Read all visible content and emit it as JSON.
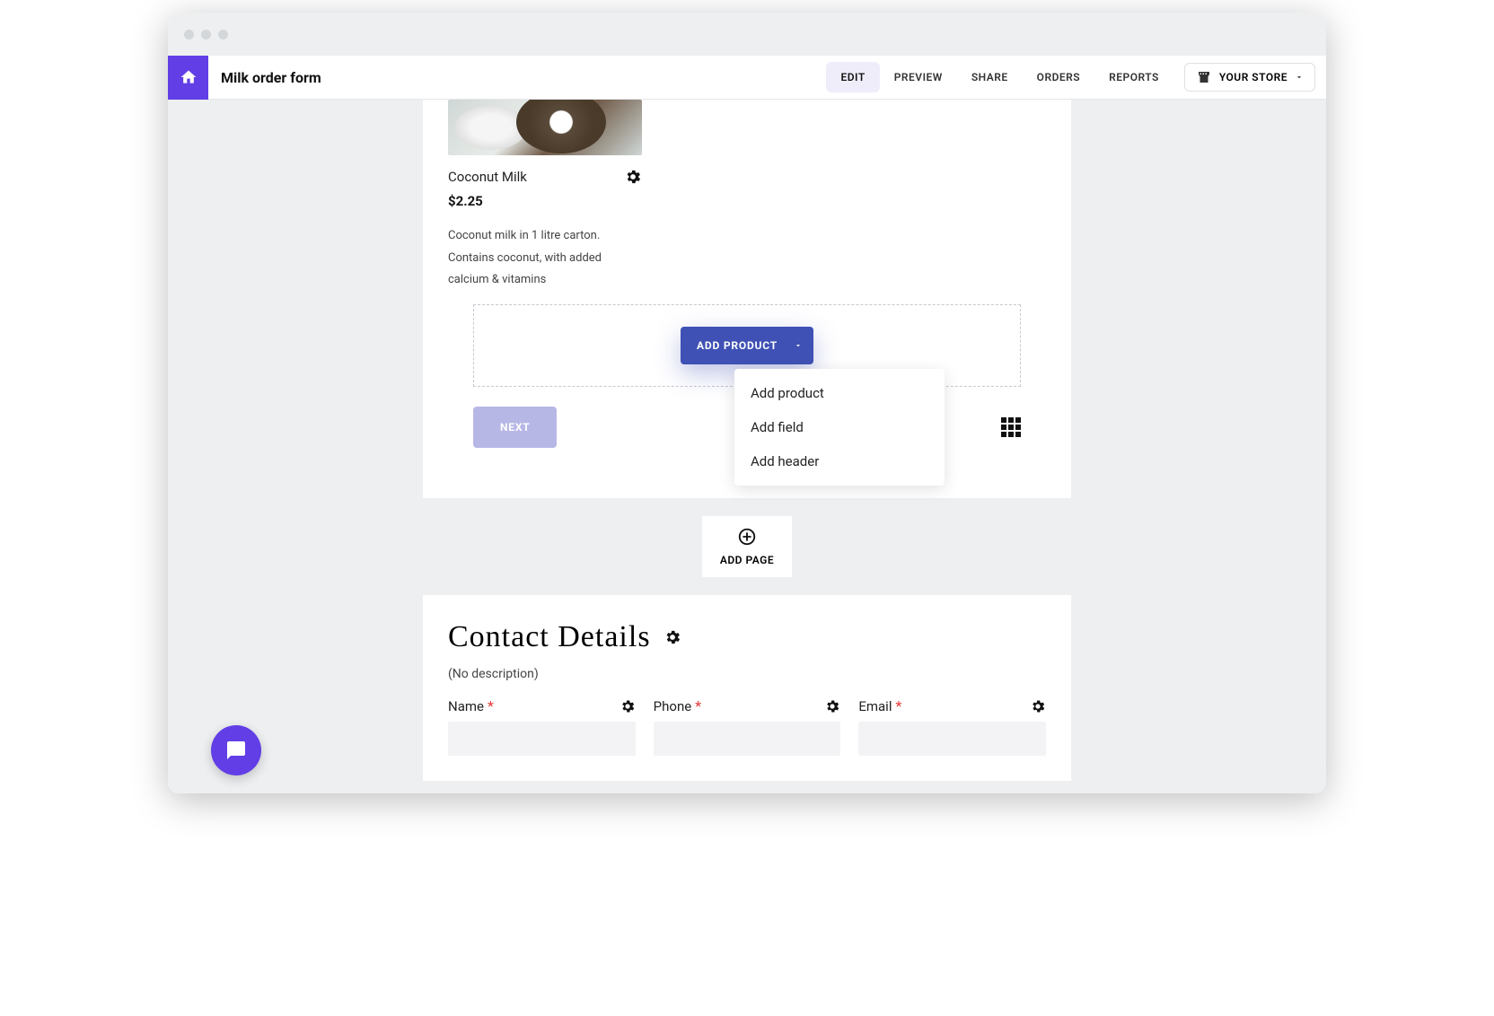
{
  "header": {
    "page_title": "Milk order form",
    "tabs": [
      "EDIT",
      "PREVIEW",
      "SHARE",
      "ORDERS",
      "REPORTS"
    ],
    "active_tab": "EDIT",
    "store_label": "YOUR STORE"
  },
  "product": {
    "name": "Coconut Milk",
    "price": "$2.25",
    "description": "Coconut milk in 1 litre carton. Contains coconut, with added calcium & vitamins"
  },
  "add_product": {
    "button_label": "ADD PRODUCT",
    "menu": [
      "Add product",
      "Add field",
      "Add header"
    ]
  },
  "next_button": "NEXT",
  "add_page_label": "ADD PAGE",
  "contact": {
    "title": "Contact Details",
    "no_description": "(No description)",
    "fields": [
      {
        "label": "Name",
        "required": true
      },
      {
        "label": "Phone",
        "required": true
      },
      {
        "label": "Email",
        "required": true
      }
    ]
  }
}
